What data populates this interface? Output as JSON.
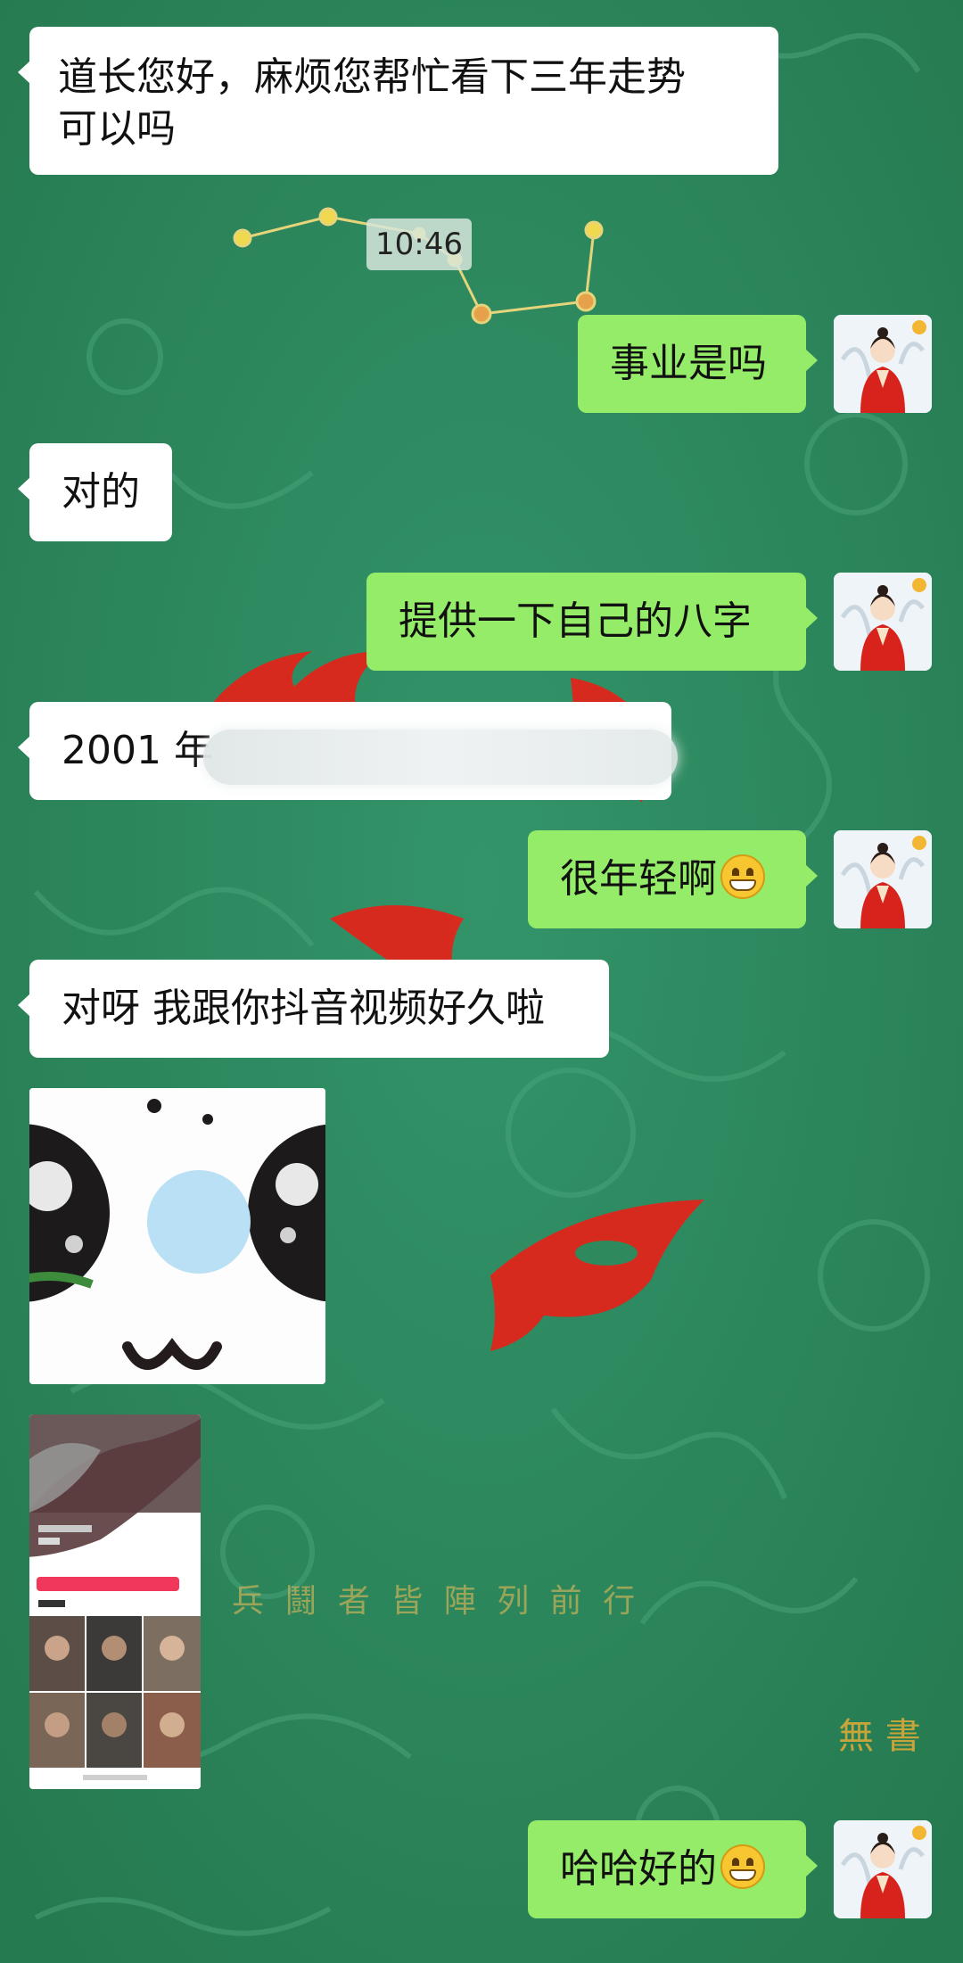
{
  "colors": {
    "background": "#2e8a5c",
    "bubble_self": "#95ec69",
    "bubble_other": "#ffffff",
    "background_motif_red": "#e0251b"
  },
  "timestamp": "10:46",
  "messages": [
    {
      "side": "left",
      "type": "text",
      "text": "道长您好，麻烦您帮忙看下三年走势\n可以吗"
    },
    {
      "side": "right",
      "type": "text",
      "text": "事业是吗"
    },
    {
      "side": "left",
      "type": "text",
      "text": "对的"
    },
    {
      "side": "right",
      "type": "text",
      "text": "提供一下自己的八字"
    },
    {
      "side": "left",
      "type": "text",
      "text": "2001 年"
    },
    {
      "side": "right",
      "type": "text",
      "text": "很年轻啊",
      "emoji": "grin-emoji"
    },
    {
      "side": "left",
      "type": "text",
      "text": "对呀 我跟你抖音视频好久啦"
    },
    {
      "side": "left",
      "type": "image",
      "icon": "cute-face-sticker"
    },
    {
      "side": "left",
      "type": "image",
      "icon": "profile-screenshot-thumbnail"
    },
    {
      "side": "right",
      "type": "text",
      "text": "哈哈好的",
      "emoji": "grin-emoji"
    }
  ],
  "background_text": {
    "motto": "兵 鬪 者 皆 陣 列 前 行",
    "vertical": "無 書"
  },
  "avatar": {
    "icon": "hanfu-girl-avatar"
  }
}
